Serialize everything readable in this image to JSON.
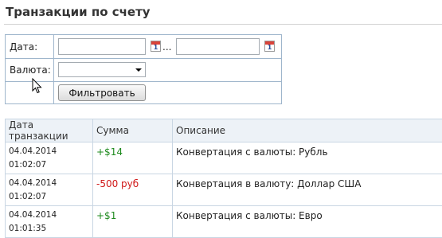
{
  "page": {
    "title": "Транзакции по счету"
  },
  "filter": {
    "date_label": "Дата:",
    "date_from": "",
    "date_to": "",
    "calendar_day": "1",
    "range_separator": "...",
    "currency_label": "Валюта:",
    "currency_selected": "",
    "filter_button": "Фильтровать"
  },
  "table": {
    "headers": [
      "Дата транзакции",
      "Сумма",
      "Описание"
    ],
    "rows": [
      {
        "date": "04.04.2014",
        "time": "01:02:07",
        "amount": "+$14",
        "amount_sign": "positive",
        "description": "Конвертация с валюты: Рубль"
      },
      {
        "date": "04.04.2014",
        "time": "01:02:07",
        "amount": "-500 руб",
        "amount_sign": "negative",
        "description": "Конвертация в валюту: Доллар США"
      },
      {
        "date": "04.04.2014",
        "time": "01:01:35",
        "amount": "+$1",
        "amount_sign": "positive",
        "description": "Конвертация с валюты: Евро"
      }
    ]
  },
  "colors": {
    "positive": "#1e8a1e",
    "negative": "#d01818",
    "border": "#9fb6cc"
  },
  "icons": [
    "calendar-icon",
    "dropdown-arrow-icon",
    "mouse-cursor-icon"
  ]
}
